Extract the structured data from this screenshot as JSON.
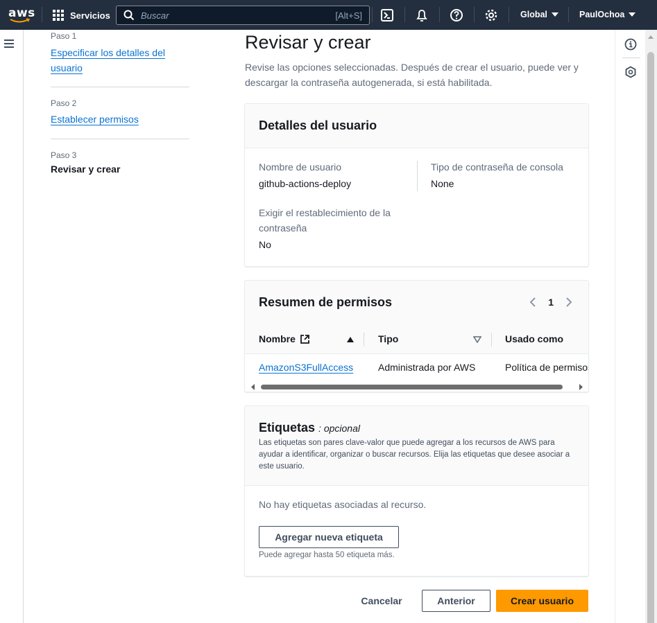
{
  "topnav": {
    "logo_text": "aws",
    "services_label": "Servicios",
    "search_placeholder": "Buscar",
    "search_shortcut": "[Alt+S]",
    "region_label": "Global",
    "user_label": "PaulOchoa",
    "icons": [
      "cloudshell-icon",
      "bell-icon",
      "help-icon",
      "settings-icon"
    ]
  },
  "steps": [
    {
      "num": "Paso 1",
      "label_line1": "Especificar los detalles del",
      "label_line2": "usuario"
    },
    {
      "num": "Paso 2",
      "label": "Establecer permisos"
    },
    {
      "num": "Paso 3",
      "label": "Revisar y crear"
    }
  ],
  "page": {
    "title": "Revisar y crear",
    "description": "Revise las opciones seleccionadas. Después de crear el usuario, puede ver y descargar la contraseña autogenerada, si está habilitada."
  },
  "user_details": {
    "title": "Detalles del usuario",
    "username_label": "Nombre de usuario",
    "username_value": "github-actions-deploy",
    "password_type_label": "Tipo de contraseña de consola",
    "password_type_value": "None",
    "reset_label_line1": "Exigir el restablecimiento de la",
    "reset_label_line2": "contraseña",
    "reset_value": "No"
  },
  "permissions": {
    "title": "Resumen de permisos",
    "page": "1",
    "columns": [
      "Nombre",
      "Tipo",
      "Usado como"
    ],
    "rows": [
      {
        "name": "AmazonS3FullAccess",
        "type": "Administrada por AWS",
        "used_as": "Política de permisos"
      }
    ]
  },
  "tags": {
    "title": "Etiquetas",
    "optional": "opcional",
    "description": "Las etiquetas son pares clave-valor que puede agregar a los recursos de AWS para ayudar a identificar, organizar o buscar recursos. Elija las etiquetas que desee asociar a este usuario.",
    "empty_text": "No hay etiquetas asociadas al recurso.",
    "add_button": "Agregar nueva etiqueta",
    "hint": "Puede agregar hasta 50 etiqueta más."
  },
  "actions": {
    "cancel": "Cancelar",
    "previous": "Anterior",
    "create": "Crear usuario"
  },
  "colors": {
    "nav_bg": "#232f3e",
    "link": "#0972d3",
    "primary": "#ff9900"
  }
}
